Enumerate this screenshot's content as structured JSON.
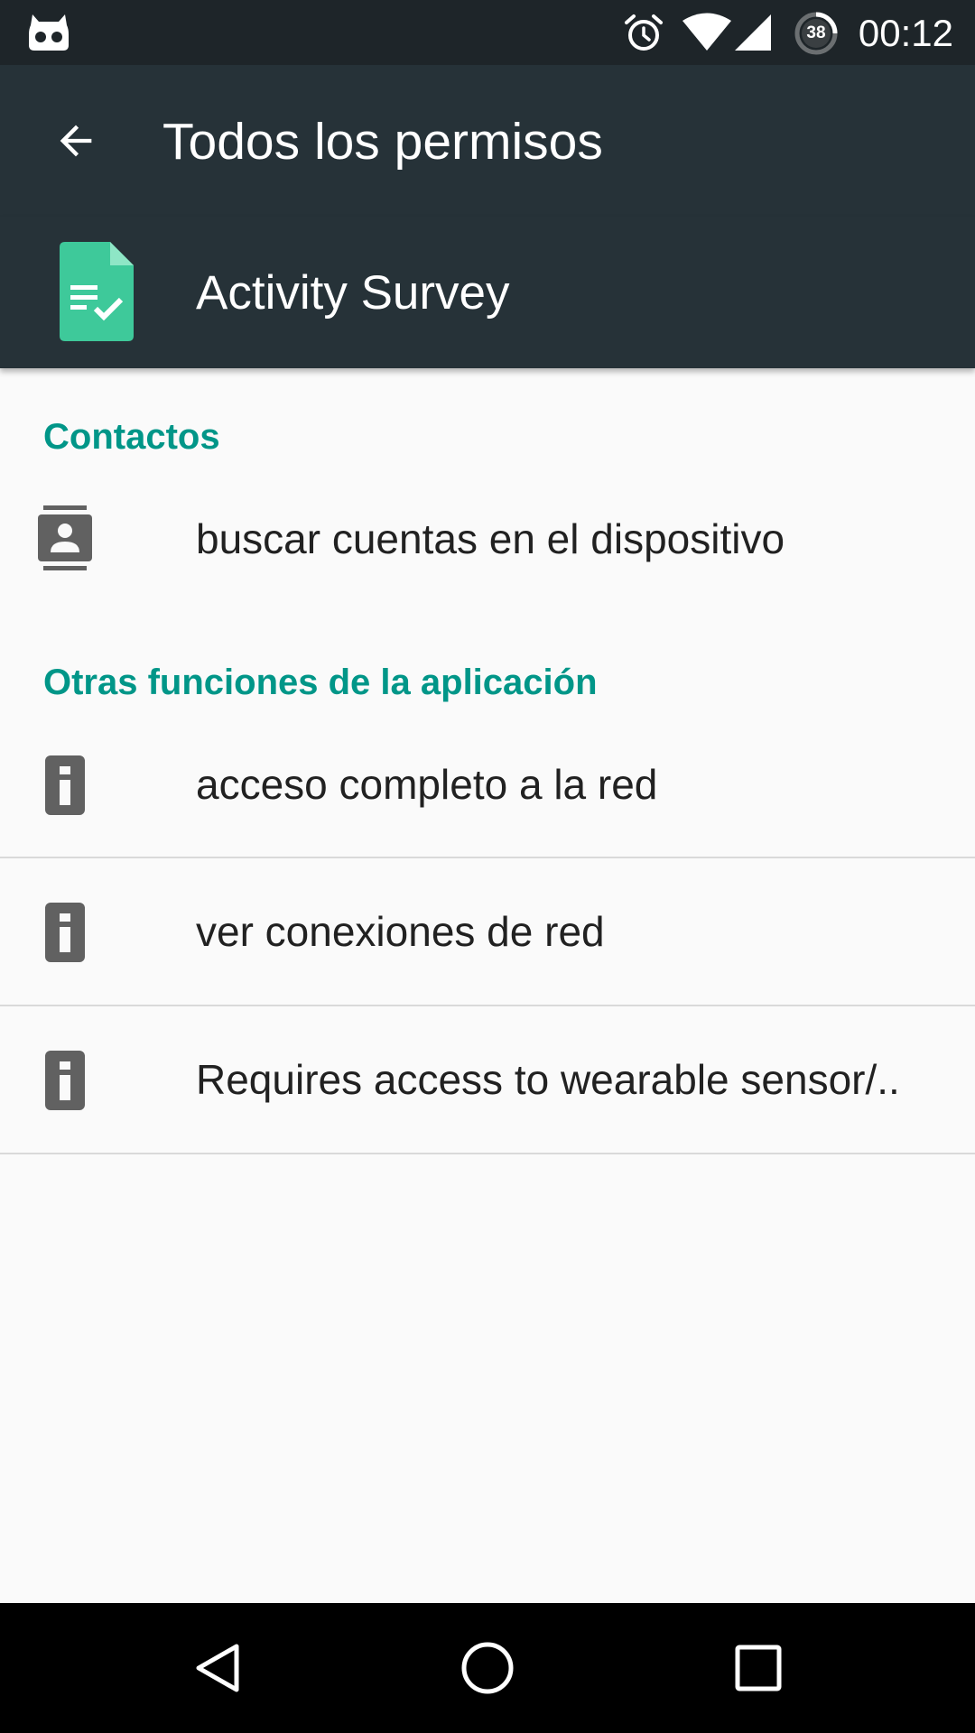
{
  "status_bar": {
    "clock": "00:12",
    "battery_level": "38",
    "icons": [
      "cyanogen-notification-icon",
      "alarm-icon",
      "wifi-icon",
      "signal-icon",
      "battery-icon"
    ]
  },
  "toolbar": {
    "title": "Todos los permisos",
    "back_icon": "arrow-back-icon"
  },
  "app": {
    "name": "Activity Survey",
    "icon": "survey-document-icon",
    "icon_color": "#3ec99a"
  },
  "sections": [
    {
      "header": "Contactos",
      "items": [
        {
          "label": "buscar cuentas en el dispositivo",
          "icon": "contacts-icon"
        }
      ]
    },
    {
      "header": "Otras funciones de la aplicación",
      "items": [
        {
          "label": "acceso completo a la red",
          "icon": "info-device-icon"
        },
        {
          "label": "ver conexiones de red",
          "icon": "info-device-icon"
        },
        {
          "label": "Requires access to wearable sensor/..",
          "icon": "info-device-icon"
        }
      ]
    }
  ],
  "navigation": {
    "buttons": [
      "back-triangle-icon",
      "home-circle-icon",
      "recents-square-icon"
    ]
  },
  "colors": {
    "status_bar": "#1e2529",
    "toolbar": "#263238",
    "accent": "#009688",
    "background": "#fafafa",
    "text_primary": "#212121",
    "icon_gray": "#616161"
  }
}
